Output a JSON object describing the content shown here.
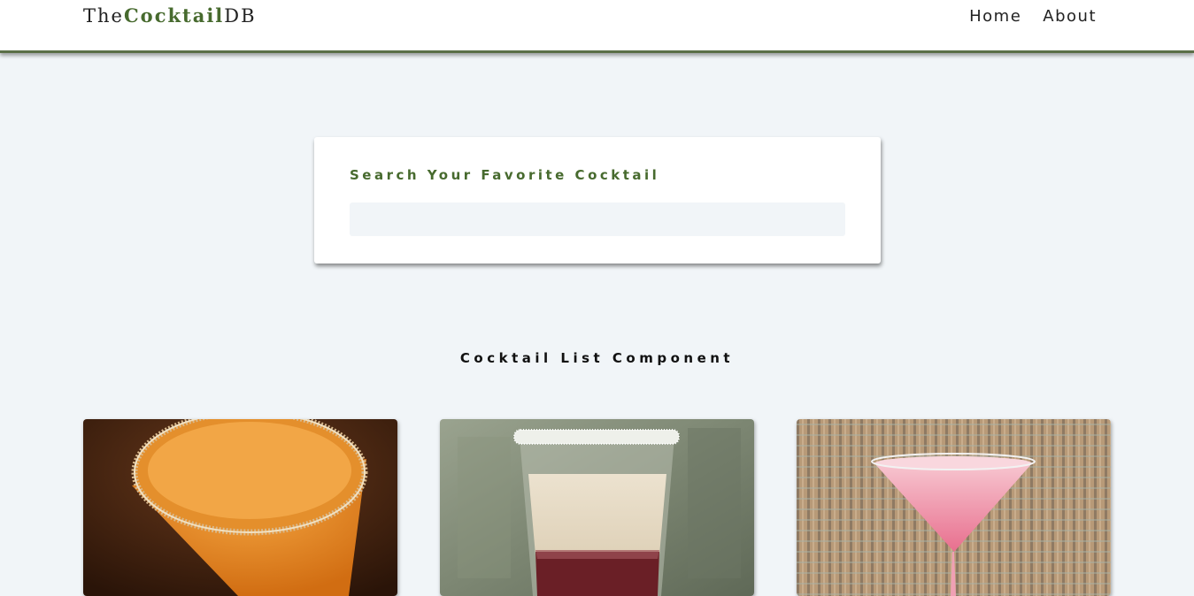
{
  "navbar": {
    "logo_prefix": "The",
    "logo_brand": "Cocktail",
    "logo_suffix": "DB",
    "links": [
      {
        "label": "Home"
      },
      {
        "label": "About"
      }
    ]
  },
  "search": {
    "label": "Search Your Favorite Cocktail",
    "value": ""
  },
  "list": {
    "title": "Cocktail List Component"
  },
  "cocktails": [
    {
      "image": "orange-martini-with-sugar-rim"
    },
    {
      "image": "cream-layered-shot-with-sugar-rim"
    },
    {
      "image": "pink-martini-cocktail"
    }
  ],
  "colors": {
    "accent": "#476a2e",
    "background": "#f1f5f8",
    "navbar_border": "#5a6f48"
  }
}
